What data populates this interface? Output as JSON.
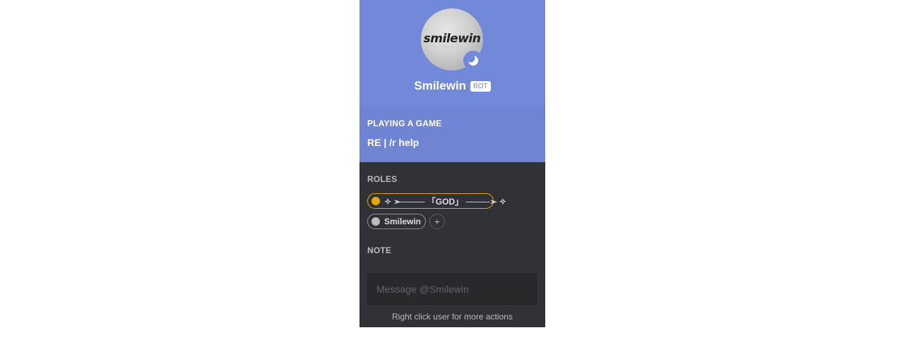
{
  "profile": {
    "avatar_text": "smilewin",
    "username": "Smilewin",
    "bot_tag": "BOT",
    "status_icon": "moon-idle-icon"
  },
  "activity": {
    "header": "PLAYING A GAME",
    "name": "RE | /r help"
  },
  "roles": {
    "title": "ROLES",
    "items": [
      {
        "label": "✧ ➣──── 「GOD」 ────➢ ✧",
        "color": "#e7a70b"
      },
      {
        "label": "Smilewin",
        "color": "#b9bbbe"
      }
    ],
    "add_label": "+"
  },
  "note": {
    "title": "NOTE"
  },
  "message": {
    "placeholder": "Message @Smilewin"
  },
  "footer": {
    "hint": "Right click user for more actions"
  },
  "colors": {
    "header_bg": "#7289da",
    "activity_bg": "#6f85d4",
    "body_bg": "#2f3136"
  }
}
